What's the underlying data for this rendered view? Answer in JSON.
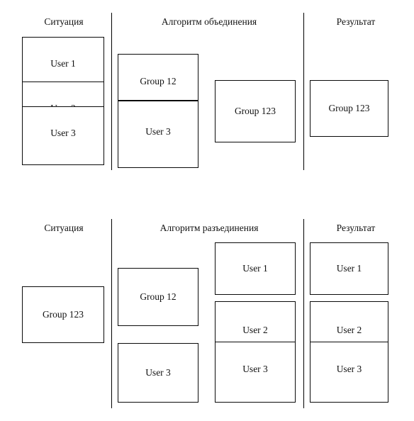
{
  "figure": {
    "panels": [
      {
        "id": "merge",
        "columns": [
          {
            "id": "situation",
            "title": "Ситуация"
          },
          {
            "id": "algorithm",
            "title": "Алгоритм объединения"
          },
          {
            "id": "result",
            "title": "Результат"
          }
        ],
        "boxes": {
          "situation": [
            "User 1",
            "User 2",
            "User 3"
          ],
          "algorithm_stack": [
            "Group 12",
            "User 3"
          ],
          "algorithm_merged": "Group 123",
          "result": "Group 123"
        }
      },
      {
        "id": "split",
        "columns": [
          {
            "id": "situation",
            "title": "Ситуация"
          },
          {
            "id": "algorithm",
            "title": "Алгоритм разъединения"
          },
          {
            "id": "result",
            "title": "Результат"
          }
        ],
        "boxes": {
          "situation": "Group 123",
          "algorithm_source": [
            "Group 12",
            "User 3"
          ],
          "algorithm_split": [
            "User 1",
            "User 2",
            "User 3"
          ],
          "result": [
            "User 1",
            "User 2",
            "User 3"
          ]
        }
      }
    ],
    "colors": {
      "stroke": "#0a0a0a",
      "text": "#111111",
      "background": "#ffffff"
    }
  }
}
